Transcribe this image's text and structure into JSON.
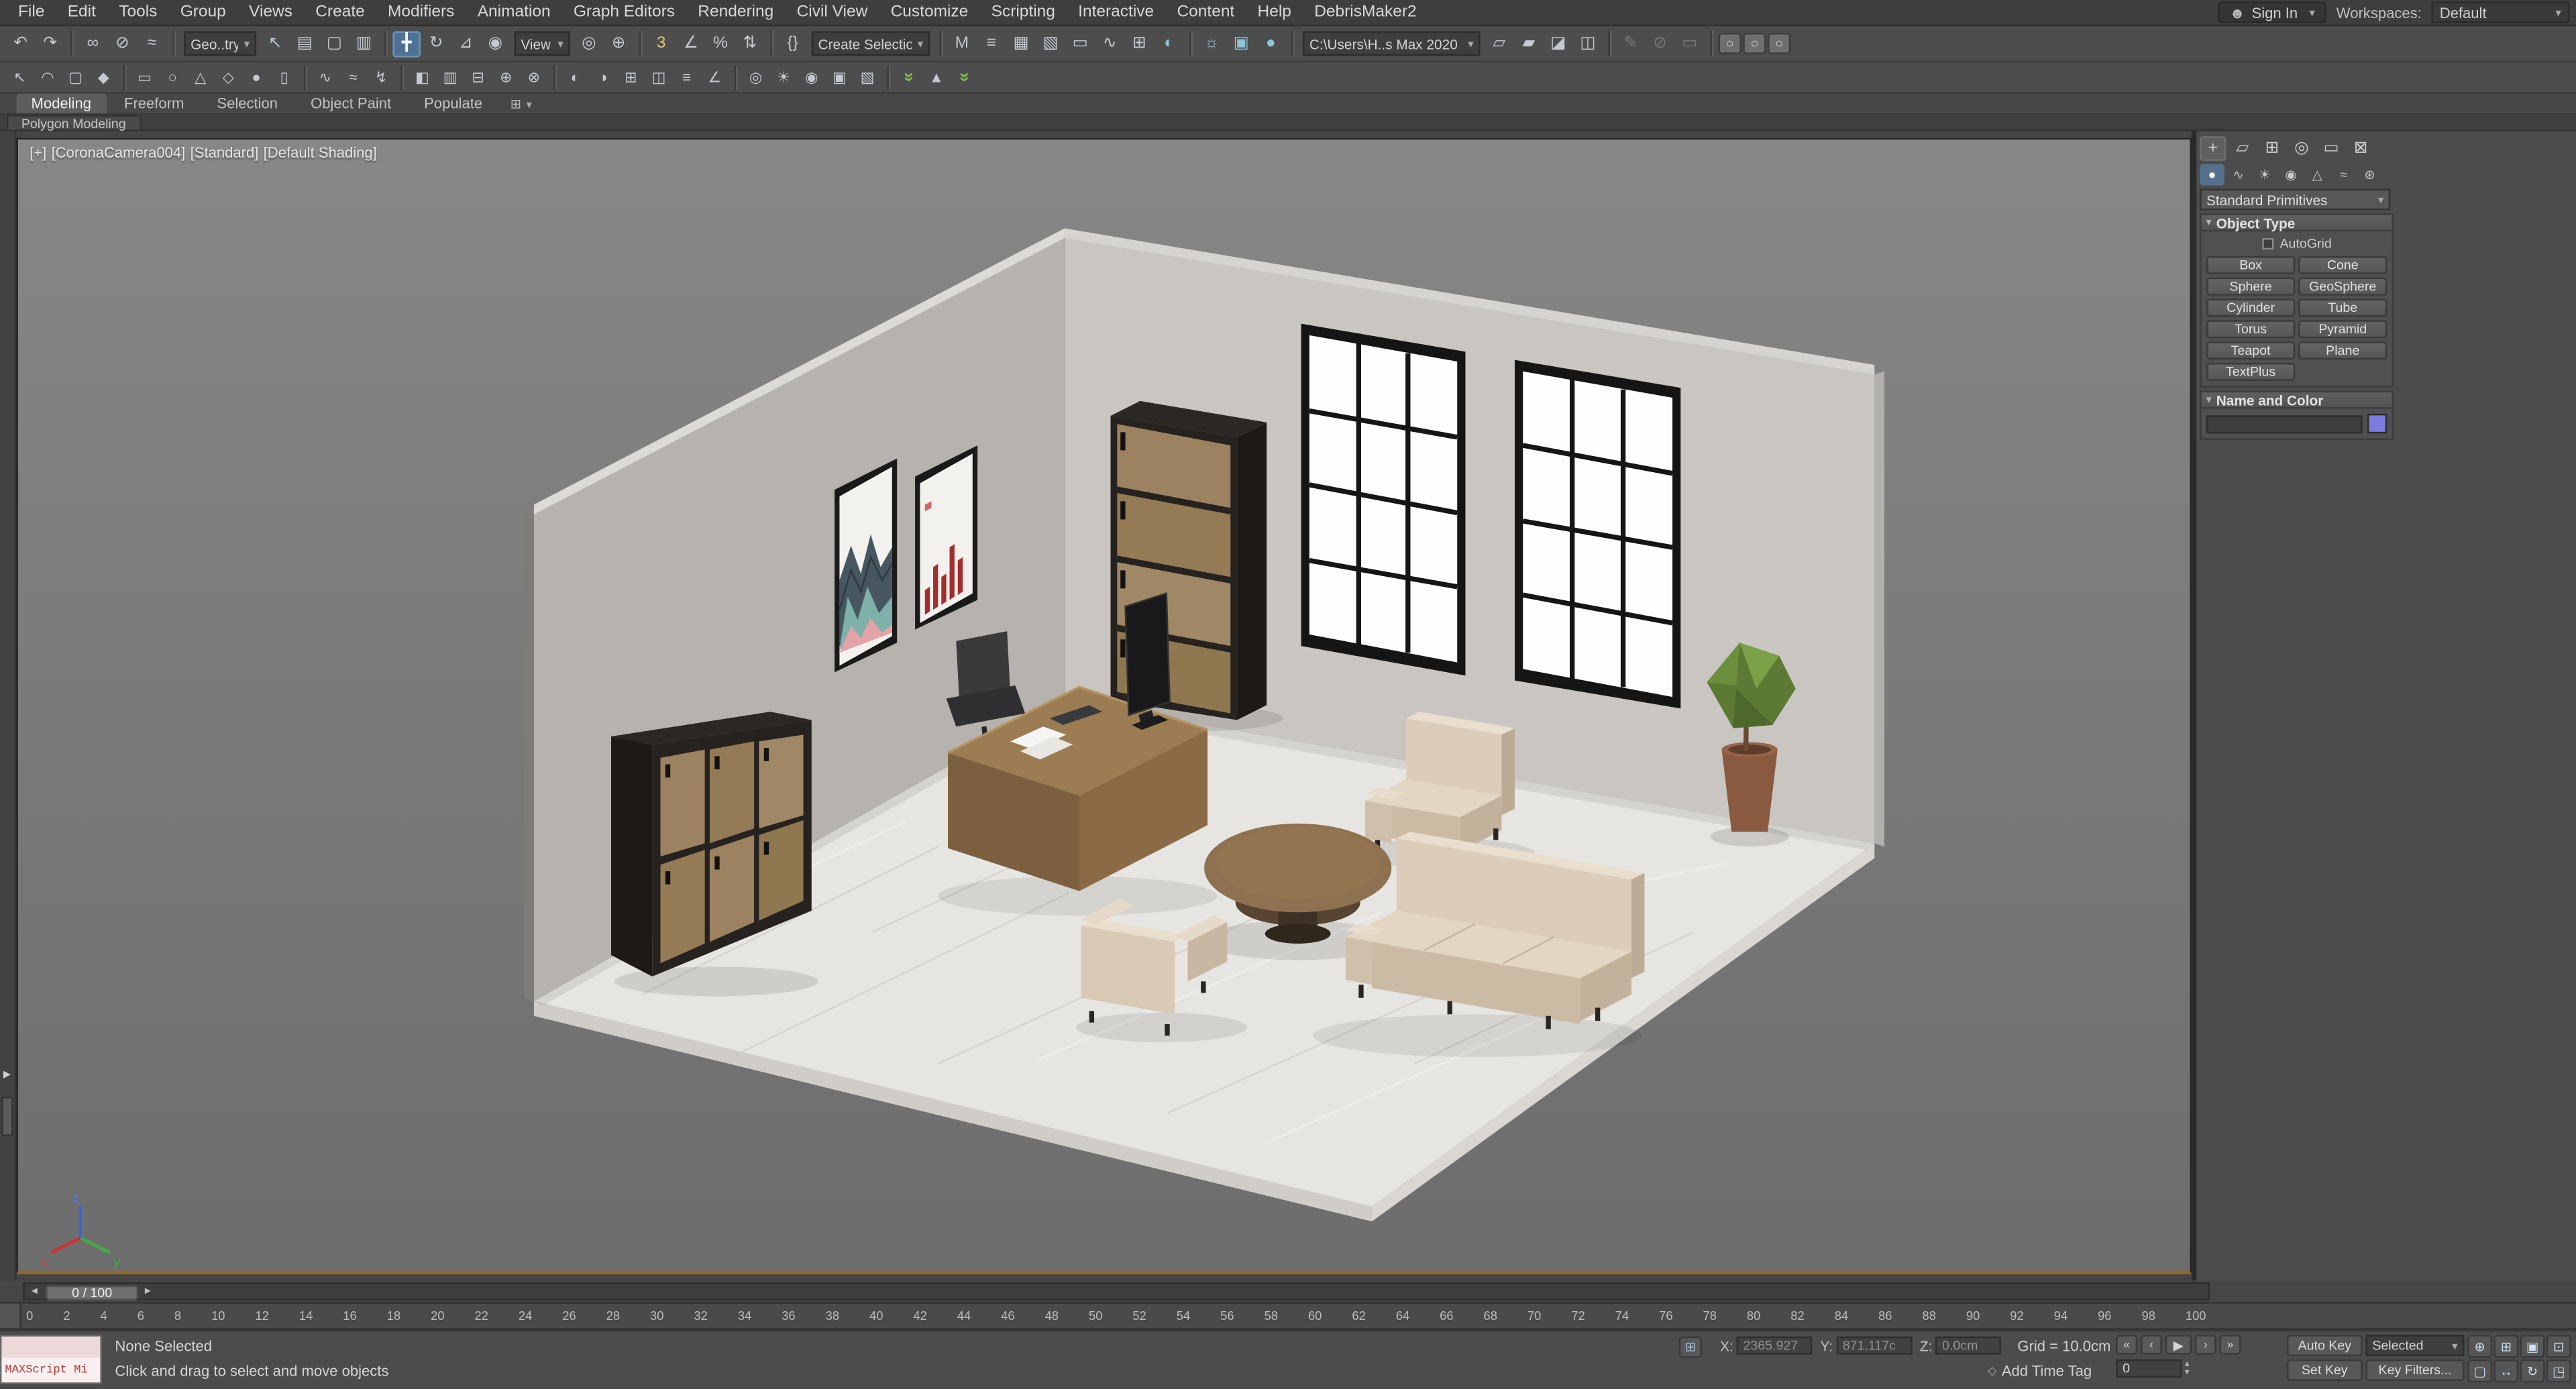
{
  "menu_bar": {
    "items": [
      "File",
      "Edit",
      "Tools",
      "Group",
      "Views",
      "Create",
      "Modifiers",
      "Animation",
      "Graph Editors",
      "Rendering",
      "Civil View",
      "Customize",
      "Scripting",
      "Interactive",
      "Content",
      "Help",
      "DebrisMaker2"
    ],
    "sign_in": "Sign In",
    "workspaces_label": "Workspaces:",
    "workspace_value": "Default"
  },
  "toolbar_main": {
    "items": [
      {
        "n": "undo-icon",
        "g": "↶"
      },
      {
        "n": "redo-icon",
        "g": "↷"
      },
      {
        "sep": true
      },
      {
        "n": "select-and-link-icon",
        "g": "∞"
      },
      {
        "n": "unlink-selection-icon",
        "g": "⊘"
      },
      {
        "n": "bind-to-space-warp-icon",
        "g": "≈"
      },
      {
        "sep": true
      },
      {
        "type": "dropdown",
        "n": "selection-filter-dropdown",
        "label": "Geo..try",
        "w": 44
      },
      {
        "n": "select-object-icon",
        "g": "↖",
        "c": "#a8c8da"
      },
      {
        "n": "select-by-name-icon",
        "g": "▤"
      },
      {
        "n": "selection-region-icon",
        "g": "▢"
      },
      {
        "n": "window-crossing-icon",
        "g": "▥"
      },
      {
        "sep": true
      },
      {
        "n": "select-and-move-icon",
        "g": "╋",
        "active": true
      },
      {
        "n": "select-and-rotate-icon",
        "g": "↻"
      },
      {
        "n": "select-and-scale-icon",
        "g": "⊿"
      },
      {
        "n": "select-and-place-icon",
        "g": "◉"
      },
      {
        "type": "dropdown",
        "n": "reference-coordinate-dropdown",
        "label": "View",
        "w": 34
      },
      {
        "n": "use-pivot-center-icon",
        "g": "◎"
      },
      {
        "n": "select-and-manipulate-icon",
        "g": "⊕"
      },
      {
        "sep": true
      },
      {
        "n": "snaps-toggle-icon",
        "g": "3",
        "c": "#dcc96e"
      },
      {
        "n": "angle-snap-icon",
        "g": "∠"
      },
      {
        "n": "percent-snap-icon",
        "g": "%"
      },
      {
        "n": "spinner-snap-icon",
        "g": "⇅"
      },
      {
        "sep": true
      },
      {
        "n": "edit-named-selections-icon",
        "g": "{}"
      },
      {
        "type": "dropdown",
        "n": "named-selection-sets-dropdown",
        "label": "Create Selection Se",
        "w": 72
      },
      {
        "sep": true
      },
      {
        "n": "mirror-icon",
        "g": "M"
      },
      {
        "n": "align-icon",
        "g": "≡"
      },
      {
        "n": "scene-explorer-icon",
        "g": "▦"
      },
      {
        "n": "layer-explorer-icon",
        "g": "▧"
      },
      {
        "n": "ribbon-toggle-icon",
        "g": "▭"
      },
      {
        "n": "curve-editor-icon",
        "g": "∿"
      },
      {
        "n": "schematic-view-icon",
        "g": "⊞"
      },
      {
        "n": "material-editor-icon",
        "g": "◐",
        "c": "#8fc4d6"
      },
      {
        "sep": true
      },
      {
        "n": "render-setup-icon",
        "g": "☼",
        "c": "#8fc4d6"
      },
      {
        "n": "rendered-frame-icon",
        "g": "▣",
        "c": "#8fc4d6"
      },
      {
        "n": "render-production-icon",
        "g": "●",
        "c": "#8fc4d6"
      },
      {
        "sep": true
      },
      {
        "type": "dropdown",
        "n": "project-path-dropdown",
        "label": "C:\\Users\\H..s Max 2020",
        "w": 108
      },
      {
        "n": "project-folder-icon",
        "g": "▱"
      },
      {
        "n": "open-folder-icon",
        "g": "▰"
      },
      {
        "n": "asset-library-icon",
        "g": "◪"
      },
      {
        "n": "asset-tracking-icon",
        "g": "◫"
      },
      {
        "sep": true
      },
      {
        "n": "edit-pencil-icon",
        "g": "✎",
        "d": true
      },
      {
        "n": "no-edit-icon",
        "g": "⊘",
        "d": true
      },
      {
        "n": "display-panel-icon",
        "g": "▭",
        "d": true
      },
      {
        "sep": true
      },
      {
        "n": "toggle-a-icon",
        "g": "○",
        "raised": true
      },
      {
        "n": "toggle-b-icon",
        "g": "○",
        "raised": true
      },
      {
        "n": "toggle-c-icon",
        "g": "○",
        "raised": true
      }
    ]
  },
  "toolbar_secondary": {
    "items": [
      {
        "n": "select-cursor-icon",
        "g": "↖"
      },
      {
        "n": "arc-mode-icon",
        "g": "◠"
      },
      {
        "n": "region-mode-icon",
        "g": "▢"
      },
      {
        "n": "vertex-mode-icon",
        "g": "◆"
      },
      {
        "sep": true
      },
      {
        "n": "create-rectangle-icon",
        "g": "▭"
      },
      {
        "n": "create-circle-icon",
        "g": "○"
      },
      {
        "n": "create-triangle-icon",
        "g": "△"
      },
      {
        "n": "create-diamond-icon",
        "g": "◇"
      },
      {
        "n": "create-sphere-icon",
        "g": "●"
      },
      {
        "n": "create-cylinder-icon",
        "g": "▯"
      },
      {
        "sep": true
      },
      {
        "n": "spline-tool-icon",
        "g": "∿"
      },
      {
        "n": "wave-tool-icon",
        "g": "≈"
      },
      {
        "n": "bolt-tool-icon",
        "g": "↯"
      },
      {
        "sep": true
      },
      {
        "n": "shade-half-icon",
        "g": "◧"
      },
      {
        "n": "shade-grid-icon",
        "g": "▥"
      },
      {
        "n": "boolean-subtract-icon",
        "g": "⊟"
      },
      {
        "n": "boolean-union-icon",
        "g": "⊕"
      },
      {
        "n": "boolean-intersect-icon",
        "g": "⊗"
      },
      {
        "sep": true
      },
      {
        "n": "hemisphere-icon",
        "g": "◐"
      },
      {
        "n": "hemisphere-alt-icon",
        "g": "◑"
      },
      {
        "n": "array-icon",
        "g": "⊞"
      },
      {
        "n": "mirror-tool-icon",
        "g": "◫"
      },
      {
        "n": "align-tool-icon",
        "g": "≡"
      },
      {
        "n": "angle-tool-icon",
        "g": "∠"
      },
      {
        "sep": true
      },
      {
        "n": "material-ball-icon",
        "g": "◎"
      },
      {
        "n": "light-tool-icon",
        "g": "☀"
      },
      {
        "n": "camera-tool-icon",
        "g": "◉"
      },
      {
        "n": "render-tool-icon",
        "g": "▣"
      },
      {
        "n": "layers-tool-icon",
        "g": "▧"
      },
      {
        "sep": true
      },
      {
        "n": "corona-chevrons-icon",
        "g": "»",
        "green": true
      },
      {
        "n": "corona-menu-icon",
        "g": "▲"
      },
      {
        "n": "corona-chevrons-2-icon",
        "g": "»",
        "green": true
      }
    ]
  },
  "ribbon": {
    "tabs": [
      {
        "label": "Modeling",
        "active": true
      },
      {
        "label": "Freeform"
      },
      {
        "label": "Selection"
      },
      {
        "label": "Object Paint"
      },
      {
        "label": "Populate"
      }
    ],
    "panel_label": "Polygon Modeling"
  },
  "viewport": {
    "label_segments": [
      "[+]",
      "[CoronaCamera004]",
      "[Standard]",
      "[Default Shading]"
    ],
    "axis_labels": {
      "x": "x",
      "y": "y",
      "z": "z"
    },
    "scene": {
      "bg_top": "#878787",
      "bg_bottom": "#6d6d6d",
      "wall_left": "#b6b2ad",
      "wall_right": "#c9c6c2",
      "floor": "#e7e5e1",
      "window_glass": "#fdfdfd",
      "frame_dark": "#151515",
      "wood": "#9c8260",
      "cabinet_dark": "#262220",
      "desk": "#9b7c53",
      "sofa": "#dbcdb9",
      "table": "#8e7150",
      "plant": "#5c7a34",
      "pot": "#8a5a40"
    }
  },
  "command_panel": {
    "tabs": [
      {
        "n": "create-tab-icon",
        "g": "+",
        "active": true
      },
      {
        "n": "modify-tab-icon",
        "g": "▱"
      },
      {
        "n": "hierarchy-tab-icon",
        "g": "⊞"
      },
      {
        "n": "motion-tab-icon",
        "g": "◎"
      },
      {
        "n": "display-tab-icon",
        "g": "▭"
      },
      {
        "n": "utilities-tab-icon",
        "g": "⊠"
      }
    ],
    "categories": [
      {
        "n": "geometry-category-icon",
        "g": "●",
        "active": true
      },
      {
        "n": "shapes-category-icon",
        "g": "∿"
      },
      {
        "n": "lights-category-icon",
        "g": "☀"
      },
      {
        "n": "cameras-category-icon",
        "g": "◉"
      },
      {
        "n": "helpers-category-icon",
        "g": "△"
      },
      {
        "n": "space-warps-category-icon",
        "g": "≈"
      },
      {
        "n": "systems-category-icon",
        "g": "⊛"
      }
    ],
    "primitives_dropdown": "Standard Primitives",
    "object_type": {
      "title": "Object Type",
      "autogrid": "AutoGrid",
      "rows": [
        [
          "Box",
          "Cone"
        ],
        [
          "Sphere",
          "GeoSphere"
        ],
        [
          "Cylinder",
          "Tube"
        ],
        [
          "Torus",
          "Pyramid"
        ],
        [
          "Teapot",
          "Plane"
        ],
        [
          "TextPlus",
          ""
        ]
      ]
    },
    "name_color": {
      "title": "Name and Color",
      "name_value": "",
      "swatch": "#7b7be0"
    }
  },
  "timeline": {
    "slider_label": "0 / 100",
    "ticks": {
      "start": 0,
      "end": 100,
      "step": 2
    }
  },
  "status_bar": {
    "maxscript_label": "MAXScript Mi",
    "selection_status": "None Selected",
    "prompt": "Click and drag to select and move objects",
    "coord_x_label": "X:",
    "coord_x": "2365.927",
    "coord_y_label": "Y:",
    "coord_y": "871.117c",
    "coord_z_label": "Z:",
    "coord_z": "0.0cm",
    "grid": "Grid = 10.0cm",
    "time_tag": "Add Time Tag",
    "auto_key": "Auto Key",
    "set_key": "Set Key",
    "key_mode": "Selected",
    "key_filters": "Key Filters...",
    "frame_value": "0",
    "playback": [
      {
        "n": "go-to-start-button",
        "g": "«"
      },
      {
        "n": "previous-frame-button",
        "g": "‹"
      },
      {
        "n": "play-button",
        "g": "▶"
      },
      {
        "n": "next-frame-button",
        "g": "›"
      },
      {
        "n": "go-to-end-button",
        "g": "»"
      }
    ],
    "nav_icons": [
      {
        "n": "zoom-icon",
        "g": "⊕"
      },
      {
        "n": "zoom-all-icon",
        "g": "⊞"
      },
      {
        "n": "zoom-extents-icon",
        "g": "▣"
      },
      {
        "n": "zoom-extents-all-icon",
        "g": "⊡"
      },
      {
        "n": "zoom-region-icon",
        "g": "▢"
      },
      {
        "n": "pan-icon",
        "g": "↔"
      },
      {
        "n": "orbit-icon",
        "g": "↻"
      },
      {
        "n": "maximize-viewport-icon",
        "g": "◳"
      }
    ]
  }
}
